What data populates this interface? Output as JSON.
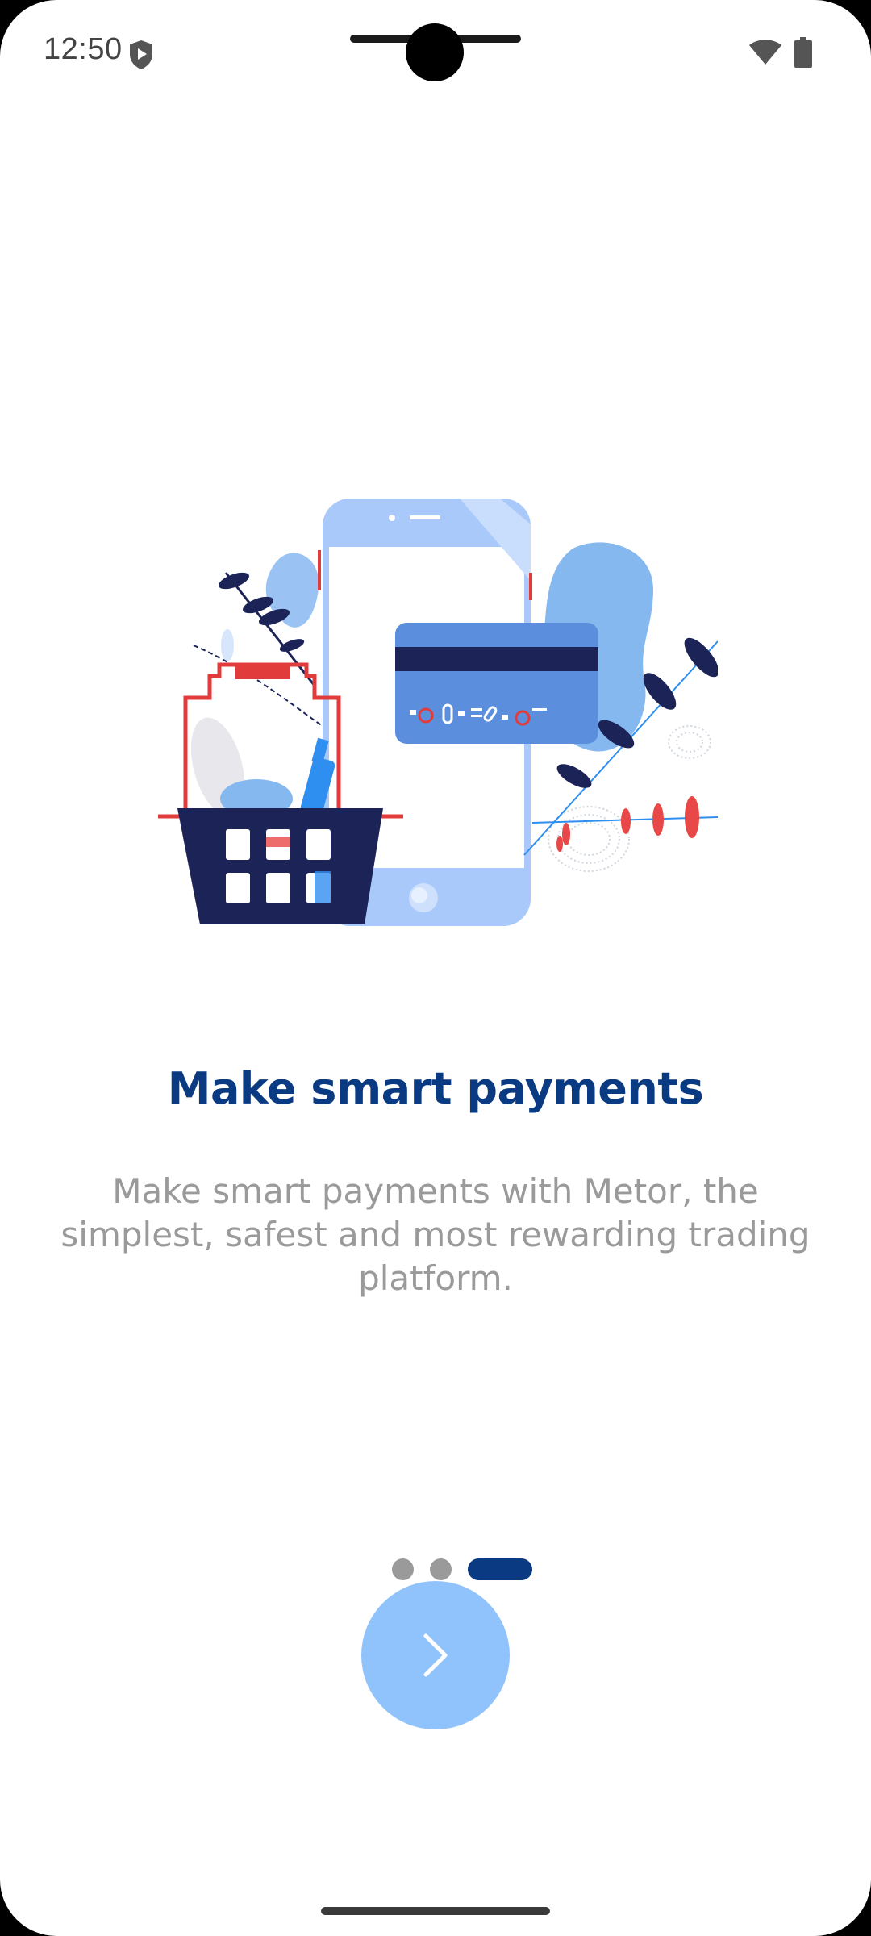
{
  "status_bar": {
    "time": "12:50",
    "icons": [
      "shield-icon",
      "wifi-icon",
      "battery-icon"
    ]
  },
  "onboarding": {
    "illustration": "smartphone-payment-illustration",
    "title": "Make smart payments",
    "description": "Make smart payments with Metor, the simplest, safest and most rewarding trading platform."
  },
  "pager": {
    "total_pages": 3,
    "current_page": 3
  },
  "next_button": {
    "icon": "chevron-right-icon"
  },
  "colors": {
    "title": "#0a3a82",
    "description": "#9a9a9a",
    "active_dot": "#0a3a82",
    "inactive_dot": "#9a9a9a",
    "next_button": "#90c2fb"
  }
}
